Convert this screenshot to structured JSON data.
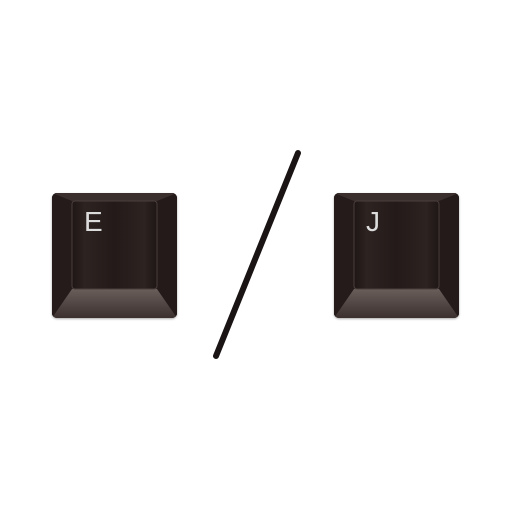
{
  "keys": [
    {
      "label": "E"
    },
    {
      "label": "J"
    }
  ],
  "separator_icon": "slash",
  "colors": {
    "background": "#ffffff",
    "key_face": "#2a1f1e",
    "key_legend": "#dcdcdc",
    "separator": "#1a1414"
  }
}
